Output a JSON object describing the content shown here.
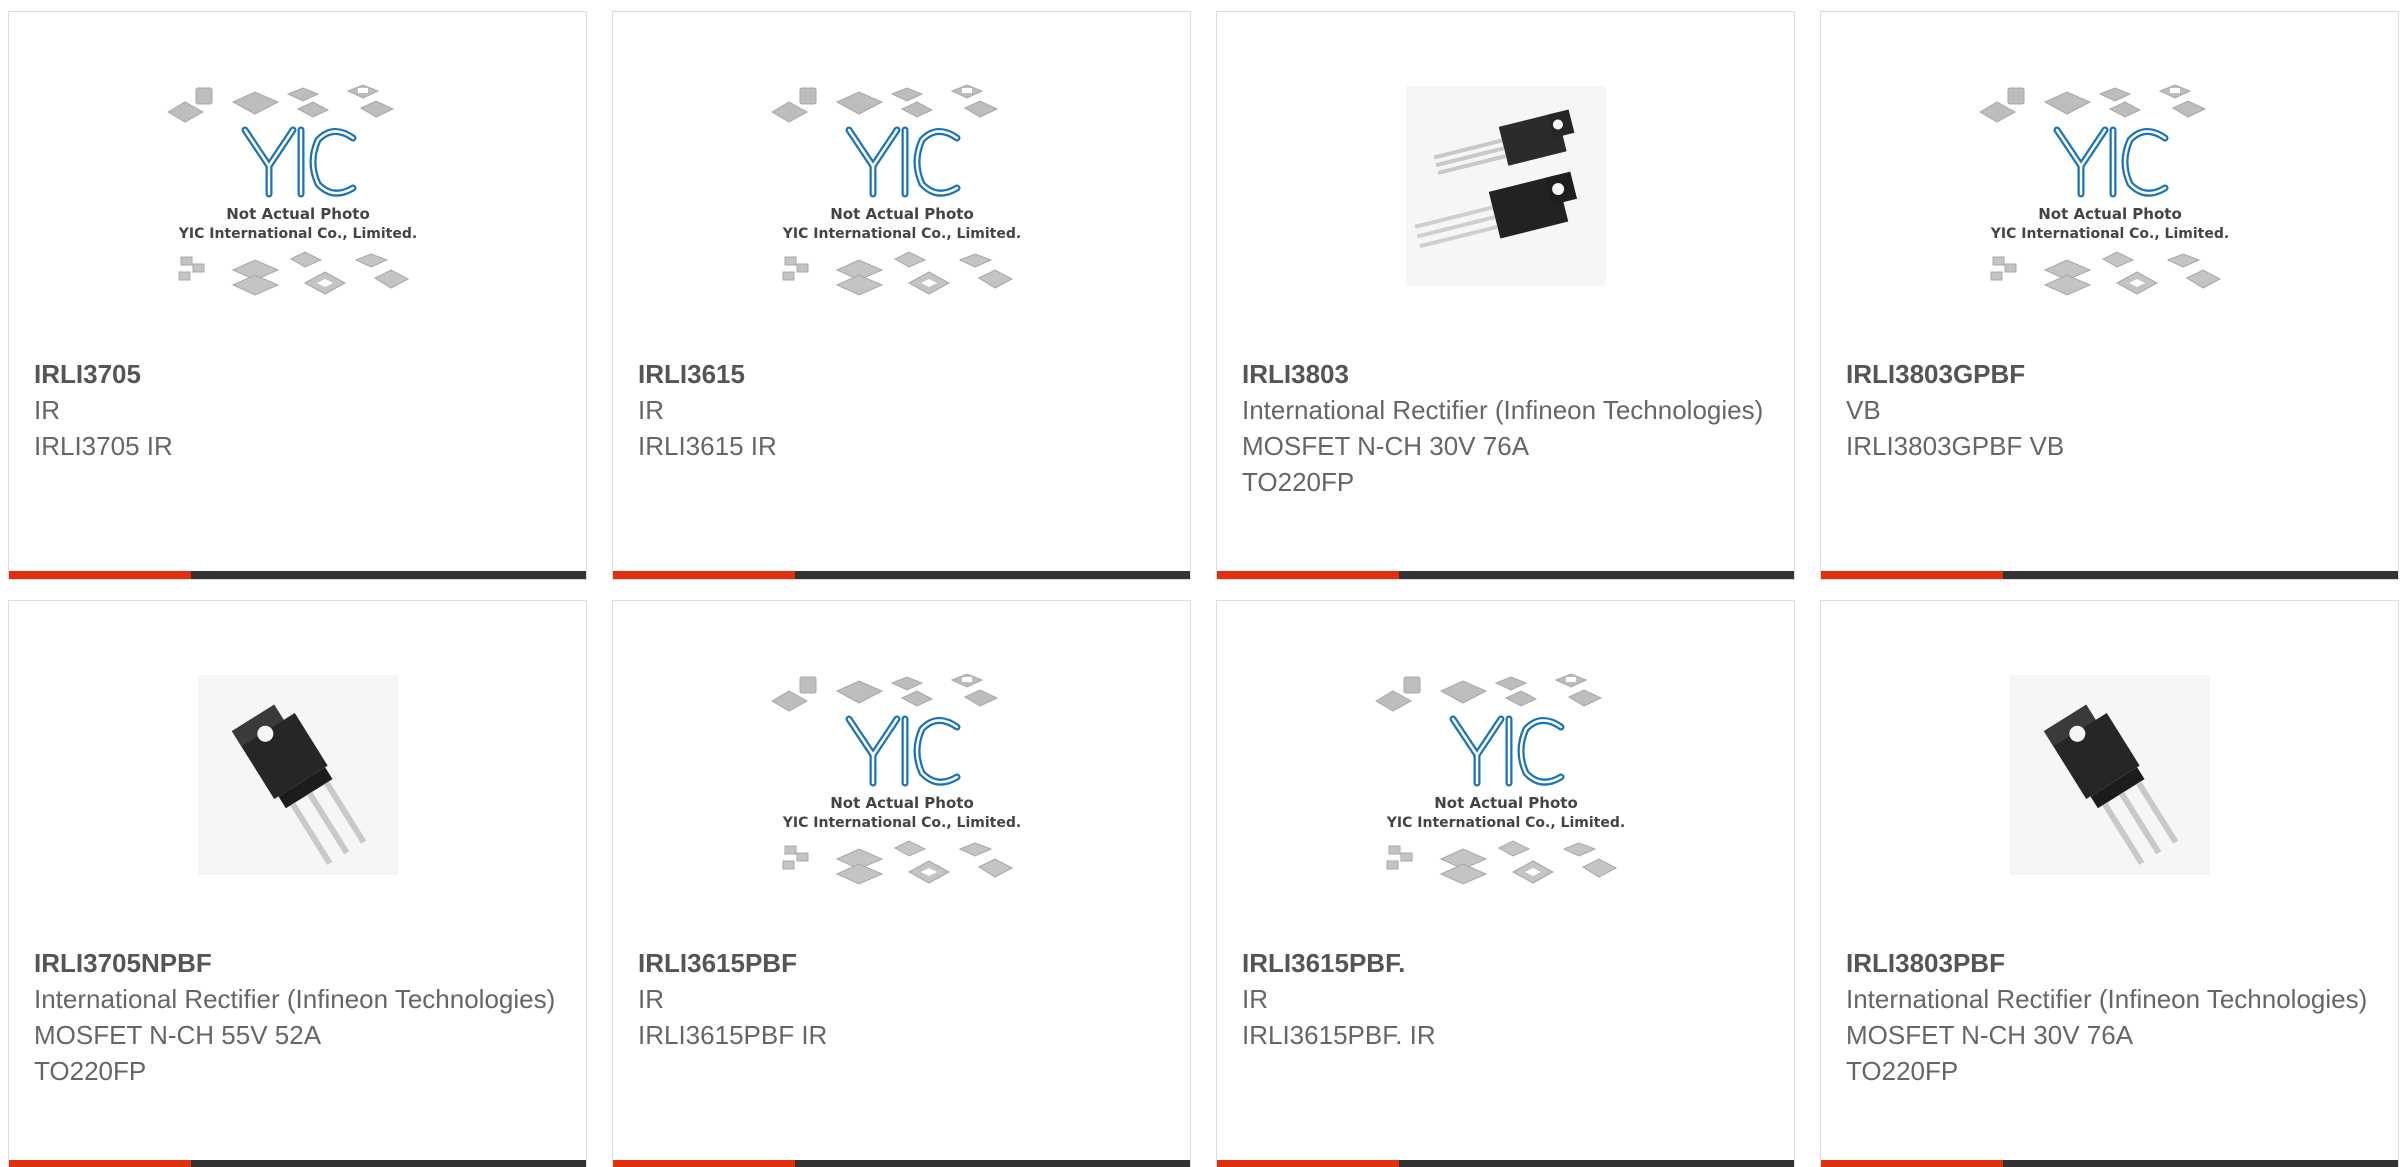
{
  "products": [
    {
      "part": "IRLI3705",
      "manufacturer": "IR",
      "description": [
        "IRLI3705 IR"
      ],
      "image": "placeholder"
    },
    {
      "part": "IRLI3615",
      "manufacturer": "IR",
      "description": [
        "IRLI3615 IR"
      ],
      "image": "placeholder"
    },
    {
      "part": "IRLI3803",
      "manufacturer": "International Rectifier (Infineon Technologies)",
      "description": [
        "MOSFET N-CH 30V 76A",
        "TO220FP"
      ],
      "image": "to220-pair"
    },
    {
      "part": "IRLI3803GPBF",
      "manufacturer": "VB",
      "description": [
        "IRLI3803GPBF VB"
      ],
      "image": "placeholder"
    },
    {
      "part": "IRLI3705NPBF",
      "manufacturer": "International Rectifier (Infineon Technologies)",
      "description": [
        "MOSFET N-CH 55V 52A",
        "TO220FP"
      ],
      "image": "to220"
    },
    {
      "part": "IRLI3615PBF",
      "manufacturer": "IR",
      "description": [
        "IRLI3615PBF IR"
      ],
      "image": "placeholder"
    },
    {
      "part": "IRLI3615PBF.",
      "manufacturer": "IR",
      "description": [
        "IRLI3615PBF. IR"
      ],
      "image": "placeholder"
    },
    {
      "part": "IRLI3803PBF",
      "manufacturer": "International Rectifier (Infineon Technologies)",
      "description": [
        "MOSFET N-CH 30V 76A",
        "TO220FP"
      ],
      "image": "to220"
    }
  ],
  "placeholder": {
    "logo": "YIC",
    "line1": "Not Actual Photo",
    "line2": "YIC International Co., Limited."
  },
  "colors": {
    "accent": "#e0300e",
    "bar": "#333333",
    "logo_blue": "#1a73b8"
  }
}
